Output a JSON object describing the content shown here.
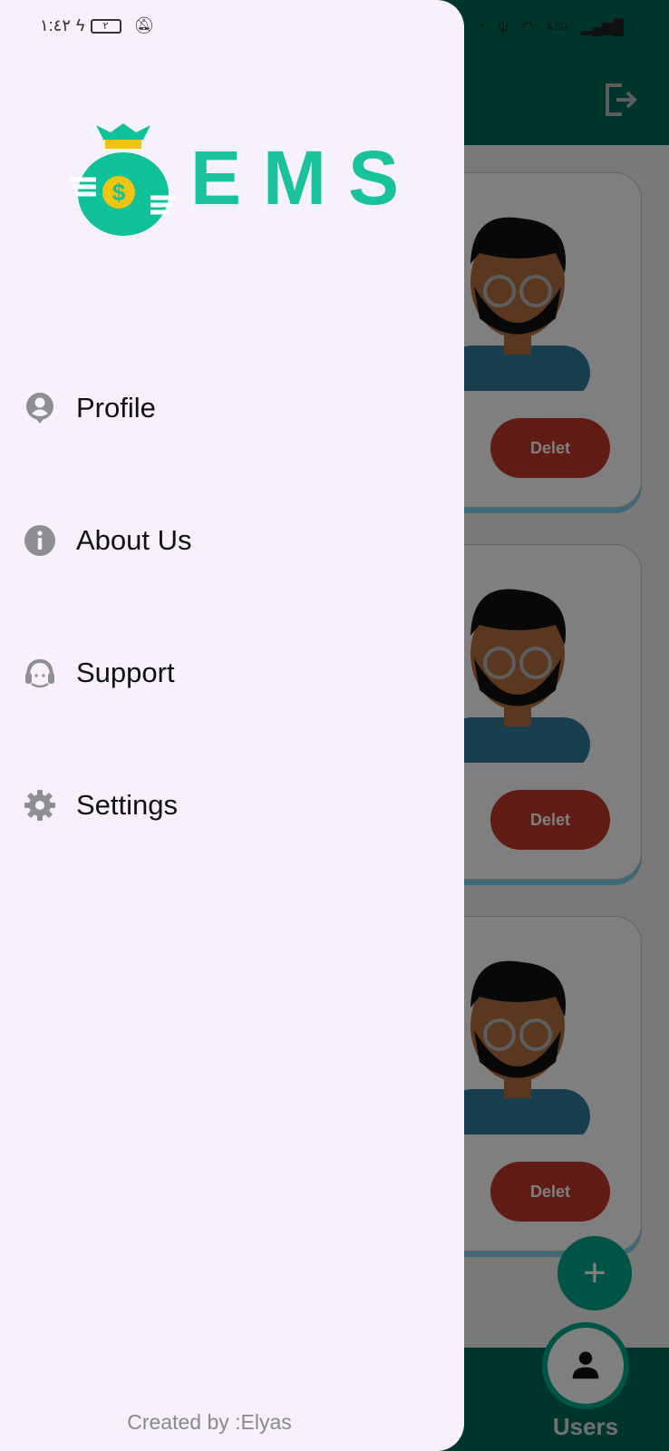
{
  "status_bar": {
    "time": "١:٤٢",
    "battery_level": "٢",
    "network_type": "4.5G"
  },
  "brand": {
    "name": "EMS",
    "accent_color": "#19c29a"
  },
  "drawer": {
    "menu": [
      {
        "label": "Profile",
        "icon": "account-circle-icon"
      },
      {
        "label": "About Us",
        "icon": "info-icon"
      },
      {
        "label": "Support",
        "icon": "headset-agent-icon"
      },
      {
        "label": "Settings",
        "icon": "gear-icon"
      }
    ],
    "footer": "Created by :Elyas"
  },
  "background": {
    "cards": [
      {
        "delete_label": "Delet"
      },
      {
        "delete_label": "Delet"
      },
      {
        "delete_label": "Delet"
      }
    ],
    "bottom_nav": {
      "active_tab": "Users"
    },
    "colors": {
      "app_bar": "#006a57",
      "fab": "#00a98a",
      "delete": "#c0392b"
    }
  }
}
